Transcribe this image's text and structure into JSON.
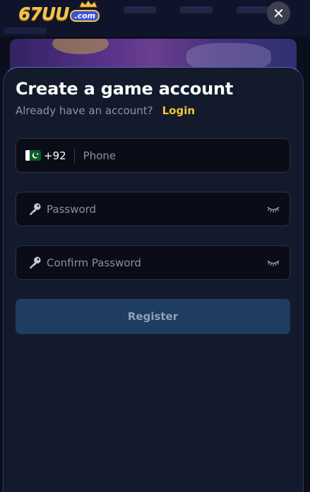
{
  "header": {
    "logo_text": "67UU",
    "logo_suffix": ".com"
  },
  "modal": {
    "close_symbol": "✕",
    "title": "Create a game account",
    "subtitle": "Already have an account?",
    "login_link": "Login",
    "phone": {
      "flag": "pakistan-flag-icon",
      "country_code": "+92",
      "placeholder": "Phone",
      "value": ""
    },
    "password": {
      "icon": "key-icon",
      "placeholder": "Password",
      "value": "",
      "toggle_icon": "eye-closed-icon"
    },
    "confirm_password": {
      "icon": "key-icon",
      "placeholder": "Confirm Password",
      "value": "",
      "toggle_icon": "eye-closed-icon"
    },
    "register_label": "Register"
  },
  "colors": {
    "background": "#0b0f1d",
    "sheet": "#131a2c",
    "field": "#0a0d18",
    "accent_gold": "#f4c430",
    "register_button": "#1f3c61",
    "register_text": "#8ba1bd",
    "muted_text": "#8c93a8"
  }
}
